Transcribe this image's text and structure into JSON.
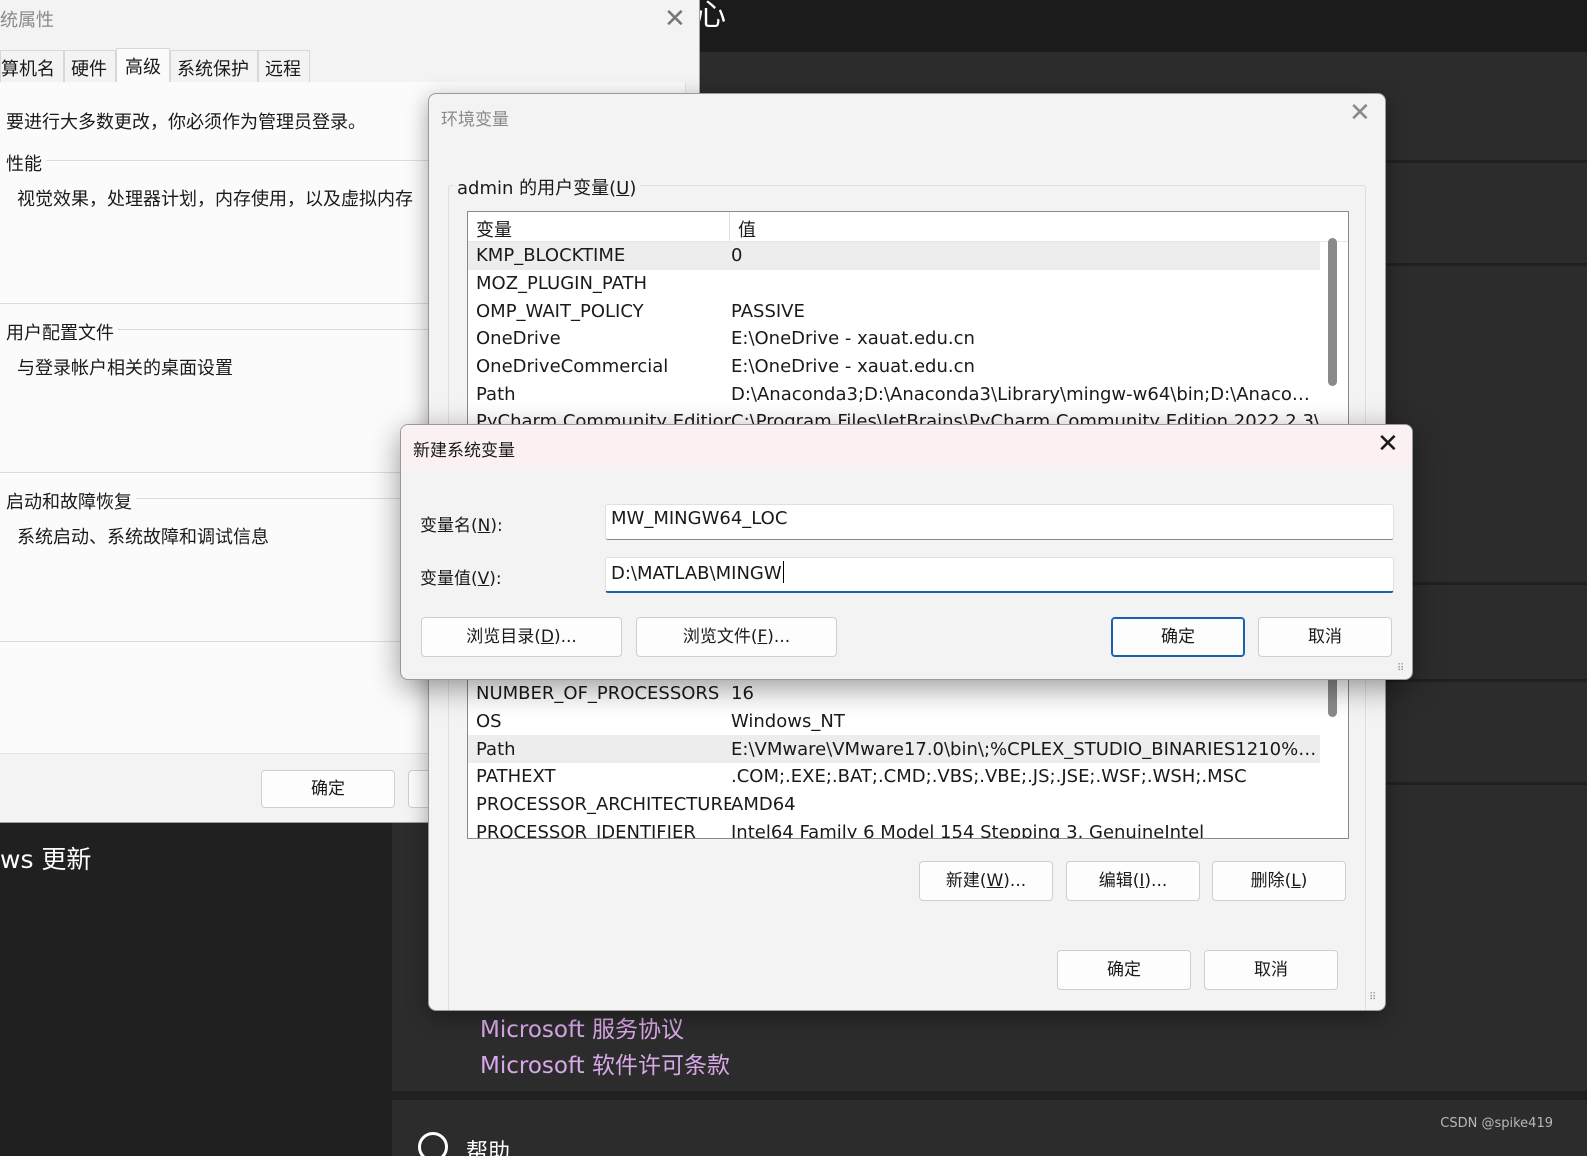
{
  "background": {
    "top_glyph": "心",
    "update_text": "ws 更新",
    "links": [
      "Microsoft 服务协议",
      "Microsoft 软件许可条款"
    ],
    "bottom_text": "帮助",
    "watermark": "CSDN @spike419"
  },
  "system_properties": {
    "title": "统属性",
    "tabs": [
      "算机名",
      "硬件",
      "高级",
      "系统保护",
      "远程"
    ],
    "active_tab": "高级",
    "admin_notice": "要进行大多数更改，你必须作为管理员登录。",
    "performance": {
      "title": "性能",
      "desc": "视觉效果，处理器计划，内存使用，以及虚拟内存"
    },
    "user_profile": {
      "title": "用户配置文件",
      "desc": "与登录帐户相关的桌面设置"
    },
    "startup": {
      "title": "启动和故障恢复",
      "desc": "系统启动、系统故障和调试信息"
    },
    "ok_label": "确定"
  },
  "env_vars": {
    "title": "环境变量",
    "user_group_label_prefix": "admin 的用户变量(",
    "user_group_label_mnemonic": "U",
    "user_group_label_suffix": ")",
    "columns": {
      "name": "变量",
      "value": "值"
    },
    "user_rows": [
      {
        "name": "KMP_BLOCKTIME",
        "value": "0"
      },
      {
        "name": "MOZ_PLUGIN_PATH",
        "value": ""
      },
      {
        "name": "OMP_WAIT_POLICY",
        "value": "PASSIVE"
      },
      {
        "name": "OneDrive",
        "value": "E:\\OneDrive - xauat.edu.cn"
      },
      {
        "name": "OneDriveCommercial",
        "value": "E:\\OneDrive - xauat.edu.cn"
      },
      {
        "name": "Path",
        "value": "D:\\Anaconda3;D:\\Anaconda3\\Library\\mingw-w64\\bin;D:\\Anacond..."
      },
      {
        "name": "PyCharm Community Edition",
        "value": "C:\\Program Files\\JetBrains\\PyCharm Community Edition 2022.2.3\\"
      }
    ],
    "system_rows": [
      {
        "name": "NUMBER_OF_PROCESSORS",
        "value": "16"
      },
      {
        "name": "OS",
        "value": "Windows_NT"
      },
      {
        "name": "Path",
        "value": "E:\\VMware\\VMware17.0\\bin\\;%CPLEX_STUDIO_BINARIES1210%;C:..."
      },
      {
        "name": "PATHEXT",
        "value": ".COM;.EXE;.BAT;.CMD;.VBS;.VBE;.JS;.JSE;.WSF;.WSH;.MSC"
      },
      {
        "name": "PROCESSOR_ARCHITECTURE",
        "value": "AMD64"
      },
      {
        "name": "PROCESSOR_IDENTIFIER",
        "value": "Intel64 Family 6 Model 154 Stepping 3, GenuineIntel"
      }
    ],
    "buttons": {
      "new": {
        "pre": "新建(",
        "key": "W",
        "post": ")..."
      },
      "edit": {
        "pre": "编辑(",
        "key": "I",
        "post": ")..."
      },
      "delete": {
        "pre": "删除(",
        "key": "L",
        "post": ")"
      },
      "ok": "确定",
      "cancel": "取消"
    }
  },
  "new_system_variable": {
    "title": "新建系统变量",
    "name_label": {
      "pre": "变量名(",
      "key": "N",
      "post": "):"
    },
    "value_label": {
      "pre": "变量值(",
      "key": "V",
      "post": "):"
    },
    "name_value": "MW_MINGW64_LOC",
    "value_value": "D:\\MATLAB\\MINGW",
    "browse_dir": {
      "pre": "浏览目录(",
      "key": "D",
      "post": ")..."
    },
    "browse_file": {
      "pre": "浏览文件(",
      "key": "F",
      "post": ")..."
    },
    "ok": "确定",
    "cancel": "取消"
  }
}
